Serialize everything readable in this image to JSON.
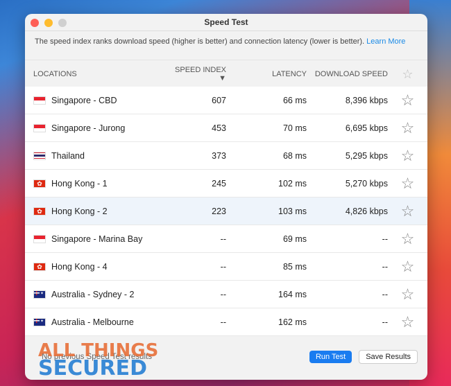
{
  "window": {
    "title": "Speed Test"
  },
  "info": {
    "text": "The speed index ranks download speed (higher is better) and connection latency (lower is better).",
    "link": "Learn More"
  },
  "columns": {
    "locations": "LOCATIONS",
    "speed_index": "SPEED INDEX",
    "sort_icon": "▼",
    "latency": "LATENCY",
    "download": "DOWNLOAD SPEED"
  },
  "rows": [
    {
      "flag": "sg",
      "location": "Singapore - CBD",
      "speed_index": "607",
      "latency": "66 ms",
      "download": "8,396 kbps"
    },
    {
      "flag": "sg",
      "location": "Singapore - Jurong",
      "speed_index": "453",
      "latency": "70 ms",
      "download": "6,695 kbps"
    },
    {
      "flag": "th",
      "location": "Thailand",
      "speed_index": "373",
      "latency": "68 ms",
      "download": "5,295 kbps"
    },
    {
      "flag": "hk",
      "location": "Hong Kong - 1",
      "speed_index": "245",
      "latency": "102 ms",
      "download": "5,270 kbps"
    },
    {
      "flag": "hk",
      "location": "Hong Kong - 2",
      "speed_index": "223",
      "latency": "103 ms",
      "download": "4,826 kbps",
      "selected": true
    },
    {
      "flag": "sg",
      "location": "Singapore - Marina Bay",
      "speed_index": "--",
      "latency": "69 ms",
      "download": "--"
    },
    {
      "flag": "hk",
      "location": "Hong Kong - 4",
      "speed_index": "--",
      "latency": "85 ms",
      "download": "--"
    },
    {
      "flag": "au",
      "location": "Australia - Sydney - 2",
      "speed_index": "--",
      "latency": "164 ms",
      "download": "--"
    },
    {
      "flag": "au",
      "location": "Australia - Melbourne",
      "speed_index": "--",
      "latency": "162 ms",
      "download": "--"
    }
  ],
  "footer": {
    "status": "No previous Speed Test results",
    "run_test": "Run Test",
    "save_results": "Save Results"
  },
  "watermark": {
    "line1": "ALL THINGS",
    "line2": "SECURED"
  },
  "colors": {
    "accent": "#1a7cf0",
    "link": "#1a8ae6"
  }
}
